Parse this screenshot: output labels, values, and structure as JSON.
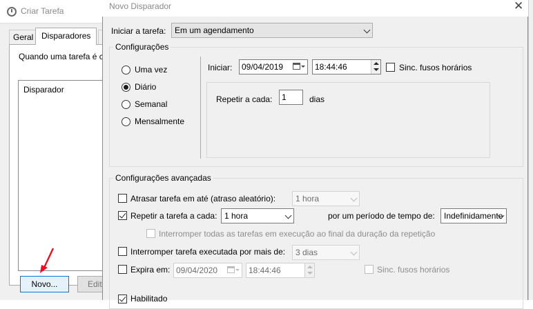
{
  "background_dialog": {
    "title": "Criar Tarefa",
    "tabs": [
      "Geral",
      "Disparadores",
      "A"
    ],
    "description": "Quando uma tarefa é c",
    "list_header": "Disparador",
    "new_button": "Novo...",
    "edit_button": "Edita"
  },
  "dialog": {
    "title": "Novo Disparador",
    "close": "✕",
    "start_task_label": "Iniciar a tarefa:",
    "start_task_value": "Em um agendamento",
    "settings": {
      "group_label": "Configurações",
      "options": [
        {
          "label": "Uma vez",
          "selected": false
        },
        {
          "label": "Diário",
          "selected": true
        },
        {
          "label": "Semanal",
          "selected": false
        },
        {
          "label": "Mensalmente",
          "selected": false
        }
      ],
      "start_label": "Iniciar:",
      "start_date": "09/04/2019",
      "start_time": "18:44:46",
      "sync_timezones": "Sinc. fusos horários",
      "sync_checked": false,
      "repeat_label": "Repetir a cada:",
      "repeat_value": "1",
      "repeat_unit": "dias"
    },
    "advanced": {
      "group_label": "Configurações avançadas",
      "delay_label": "Atrasar tarefa em até (atraso aleatório):",
      "delay_checked": false,
      "delay_value": "1 hora",
      "repeat_label": "Repetir a tarefa a cada:",
      "repeat_checked": true,
      "repeat_value": "1 hora",
      "duration_label": "por um período de tempo de:",
      "duration_value": "Indefinidamente",
      "stop_all_label": "Interromper todas as tarefas em execução ao final da duração da repetição",
      "stop_all_checked": false,
      "stop_if_label": "Interromper tarefa executada por mais de:",
      "stop_if_checked": false,
      "stop_if_value": "3 dias",
      "expire_label": "Expira em:",
      "expire_checked": false,
      "expire_date": "09/04/2020",
      "expire_time": "18:44:46",
      "expire_sync": "Sinc. fusos horários",
      "enabled_label": "Habilitado",
      "enabled_checked": true
    }
  },
  "colors": {
    "dialog_bg": "#f0f0f0",
    "accent": "#0078d7",
    "annotation_arrow": "#e81123"
  }
}
